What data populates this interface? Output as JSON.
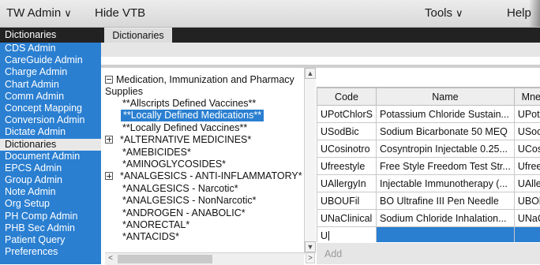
{
  "menubar": {
    "app_menu": "TW Admin",
    "hide_vtb": "Hide VTB",
    "tools": "Tools",
    "help": "Help"
  },
  "left_nav": {
    "header": "Dictionaries",
    "items": [
      {
        "label": "CDS Admin",
        "active": false
      },
      {
        "label": "CareGuide Admin",
        "active": false
      },
      {
        "label": "Charge Admin",
        "active": false
      },
      {
        "label": "Chart Admin",
        "active": false
      },
      {
        "label": "Comm Admin",
        "active": false
      },
      {
        "label": "Concept Mapping",
        "active": false
      },
      {
        "label": "Conversion Admin",
        "active": false
      },
      {
        "label": "Dictate Admin",
        "active": false
      },
      {
        "label": "Dictionaries",
        "active": true
      },
      {
        "label": "Document Admin",
        "active": false
      },
      {
        "label": "EPCS Admin",
        "active": false
      },
      {
        "label": "Group Admin",
        "active": false
      },
      {
        "label": "Note Admin",
        "active": false
      },
      {
        "label": "Org Setup",
        "active": false
      },
      {
        "label": "PH Comp Admin",
        "active": false
      },
      {
        "label": "PHB Sec Admin",
        "active": false
      },
      {
        "label": "Patient Query",
        "active": false
      },
      {
        "label": "Preferences",
        "active": false
      }
    ]
  },
  "tabs": [
    {
      "label": "Dictionaries"
    }
  ],
  "tree": {
    "root": "Medication, Immunization and Pharmacy",
    "root_cont": "Supplies",
    "children": [
      {
        "label": "**Allscripts Defined Vaccines**",
        "expander": "none",
        "selected": false
      },
      {
        "label": "**Locally Defined Medications**",
        "expander": "none",
        "selected": true
      },
      {
        "label": "**Locally Defined Vaccines**",
        "expander": "none",
        "selected": false
      },
      {
        "label": "*ALTERNATIVE MEDICINES*",
        "expander": "plus",
        "selected": false
      },
      {
        "label": "*AMEBICIDES*",
        "expander": "none",
        "selected": false
      },
      {
        "label": "*AMINOGLYCOSIDES*",
        "expander": "none",
        "selected": false
      },
      {
        "label": "*ANALGESICS - ANTI-INFLAMMATORY*",
        "expander": "plus",
        "selected": false
      },
      {
        "label": "*ANALGESICS - Narcotic*",
        "expander": "none",
        "selected": false
      },
      {
        "label": "*ANALGESICS - NonNarcotic*",
        "expander": "none",
        "selected": false
      },
      {
        "label": "*ANDROGEN - ANABOLIC*",
        "expander": "none",
        "selected": false
      },
      {
        "label": "*ANORECTAL*",
        "expander": "none",
        "selected": false
      },
      {
        "label": "*ANTACIDS*",
        "expander": "none",
        "selected": false
      }
    ]
  },
  "grid": {
    "columns": [
      "Code",
      "Name",
      "Mne"
    ],
    "rows": [
      [
        "UPotChlorS",
        "Potassium Chloride Sustain...",
        "UPot"
      ],
      [
        "USodBic",
        "Sodium Bicarbonate 50 MEQ",
        "USoc"
      ],
      [
        "UCosinotro",
        "Cosyntropin Injectable 0.25...",
        "UCos"
      ],
      [
        "Ufreestyle",
        "Free Style Freedom Test Str...",
        "Ufree"
      ],
      [
        "UAllergyIn",
        "Injectable Immunotherapy (...",
        "UAlle"
      ],
      [
        "UBOUFil",
        "BO Ultrafine III Pen Needle",
        "UBOl"
      ],
      [
        "UNaClinical",
        "Sodium Chloride Inhalation...",
        "UNaC"
      ]
    ],
    "edit_row_value": "U",
    "add_label": "Add"
  }
}
